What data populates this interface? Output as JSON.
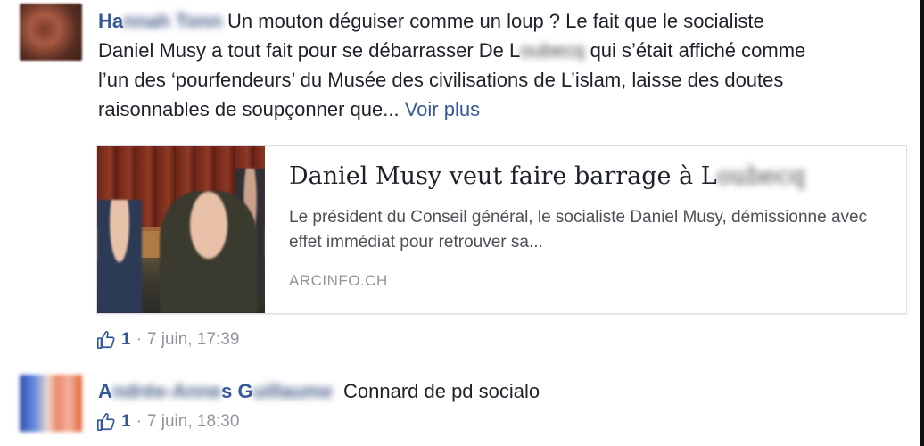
{
  "comments": [
    {
      "author_visible": "Ha",
      "author_blurred": "nnah Tonn",
      "text_lines": [
        "Un mouton déguiser comme un loup ? Le fait que le socialiste",
        "Daniel Musy a tout fait pour se débarrasser De L",
        "qui s’était affiché comme",
        "l’un des ‘pourfendeurs’ du Musée des civilisations de L’islam, laisse des doutes",
        "raisonnables de soupçonner que..."
      ],
      "blurred_name_inline": "oubecq",
      "see_more": "Voir plus",
      "link_preview": {
        "title": "Daniel Musy veut faire barrage à L",
        "title_blurred": "oubecq",
        "description": "Le président du Conseil général, le socialiste Daniel Musy, démissionne avec effet immédiat pour retrouver sa...",
        "domain": "ARCINFO.CH"
      },
      "likes": "1",
      "timestamp": "7 juin, 17:39",
      "separator": "·"
    },
    {
      "author_visible": "A",
      "author_blurred": "ndrée-Anne",
      "author_visible2": "s G",
      "author_blurred2": "uillaume",
      "text": "Connard de pd socialo",
      "likes": "1",
      "timestamp": "7 juin, 18:30",
      "separator": "·"
    }
  ],
  "colors": {
    "link": "#365899",
    "meta": "#90949c",
    "text": "#1d2129"
  },
  "icons": [
    "like-icon"
  ]
}
